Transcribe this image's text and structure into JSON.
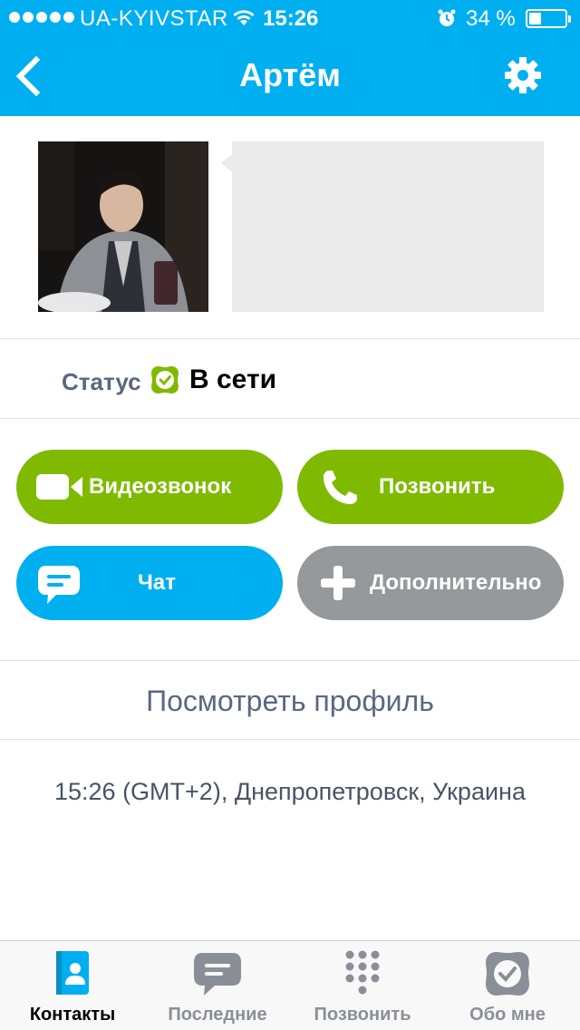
{
  "statusbar": {
    "carrier": "UA-KYIVSTAR",
    "time": "15:26",
    "battery": "34 %",
    "battery_level": 0.34
  },
  "header": {
    "title": "Артём"
  },
  "status": {
    "label": "Статус",
    "value": "В сети"
  },
  "actions": {
    "video_call": "Видеозвонок",
    "call": "Позвонить",
    "chat": "Чат",
    "more": "Дополнительно"
  },
  "profile": {
    "view_profile": "Посмотреть профиль",
    "local_time": "15:26 (GMT+2), Днепропетровск, Украина"
  },
  "tabs": [
    {
      "label": "Контакты",
      "icon": "contacts-icon",
      "active": true
    },
    {
      "label": "Последние",
      "icon": "recent-chat-icon",
      "active": false
    },
    {
      "label": "Позвонить",
      "icon": "dialpad-icon",
      "active": false
    },
    {
      "label": "Обо мне",
      "icon": "profile-check-icon",
      "active": false
    }
  ],
  "colors": {
    "accent_blue": "#00aff0",
    "action_green": "#7fba00",
    "action_grey": "#96999c",
    "online_green": "#7fba00",
    "link_text": "#5b6781"
  }
}
